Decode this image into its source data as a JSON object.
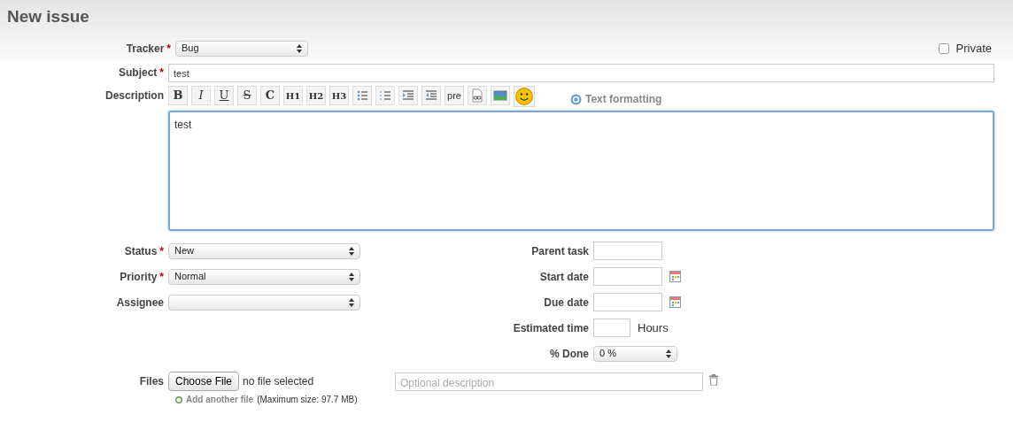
{
  "title": "New issue",
  "tracker": {
    "label": "Tracker",
    "required_mark": "*",
    "value": "Bug"
  },
  "private": {
    "label": "Private",
    "checked": false
  },
  "subject": {
    "label": "Subject",
    "required_mark": "*",
    "value": "test"
  },
  "description": {
    "label": "Description",
    "value": "test",
    "help": "Text formatting",
    "toolbar": [
      {
        "kind": "bold",
        "label": "B"
      },
      {
        "kind": "italic",
        "label": "I"
      },
      {
        "kind": "underline",
        "label": "U"
      },
      {
        "kind": "strike",
        "label": "S"
      },
      {
        "kind": "bold",
        "label": "C"
      },
      {
        "kind": "heading",
        "label": "H1"
      },
      {
        "kind": "heading",
        "label": "H2"
      },
      {
        "kind": "heading",
        "label": "H3"
      },
      {
        "kind": "bullets"
      },
      {
        "kind": "numbers"
      },
      {
        "kind": "indent"
      },
      {
        "kind": "outdent"
      },
      {
        "kind": "pre",
        "label": "pre"
      },
      {
        "kind": "link"
      },
      {
        "kind": "image"
      },
      {
        "kind": "smiley"
      }
    ]
  },
  "left_fields": [
    {
      "label": "Status",
      "required_mark": "*",
      "value": "New"
    },
    {
      "label": "Priority",
      "required_mark": "*",
      "value": "Normal"
    },
    {
      "label": "Assignee"
    }
  ],
  "right_fields": [
    {
      "kind": "text",
      "label": "Parent task"
    },
    {
      "kind": "date",
      "label": "Start date"
    },
    {
      "kind": "date",
      "label": "Due date"
    },
    {
      "kind": "hours",
      "label": "Estimated time",
      "unit": "Hours"
    },
    {
      "kind": "select",
      "label": "% Done",
      "value": "0 %"
    }
  ],
  "files": {
    "label": "Files",
    "button": "Choose File",
    "status": "no file selected",
    "placeholder": "Optional description",
    "add_link": "Add another file",
    "max_size": "(Maximum size: 97.7 MB)"
  }
}
